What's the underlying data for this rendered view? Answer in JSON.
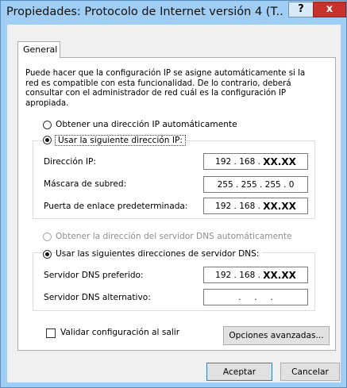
{
  "window": {
    "title": "Propiedades: Protocolo de Internet versión 4 (T...",
    "help_label": "?",
    "close_label": "x"
  },
  "tabs": [
    {
      "label": "General"
    }
  ],
  "description": "Puede hacer que la configuración IP se asigne automáticamente si la red es compatible con esta funcionalidad. De lo contrario, deberá consultar con el administrador de red cuál es la configuración IP apropiada.",
  "ip": {
    "auto_label": "Obtener una dirección IP automáticamente",
    "manual_label": "Usar la siguiente dirección IP:",
    "auto_selected": false,
    "fields": [
      {
        "label": "Dirección IP:",
        "value_prefix": "192 . 168 . ",
        "value_suffix": "XX.XX"
      },
      {
        "label": "Máscara de subred:",
        "value_prefix": "255 . 255 . 255 . 0",
        "value_suffix": ""
      },
      {
        "label": "Puerta de enlace predeterminada:",
        "value_prefix": "192 . 168 . ",
        "value_suffix": "XX.XX"
      }
    ]
  },
  "dns": {
    "auto_label": "Obtener la dirección del servidor DNS automáticamente",
    "manual_label": "Usar las siguientes direcciones de servidor DNS:",
    "fields": [
      {
        "label": "Servidor DNS preferido:",
        "value_prefix": "192 . 168 . ",
        "value_suffix": "XX.XX"
      },
      {
        "label": "Servidor DNS alternativo:",
        "value_prefix": ".     .     .",
        "value_suffix": ""
      }
    ]
  },
  "validate_label": "Validar configuración al salir",
  "validate_checked": false,
  "advanced_label": "Opciones avanzadas...",
  "ok_label": "Aceptar",
  "cancel_label": "Cancelar"
}
